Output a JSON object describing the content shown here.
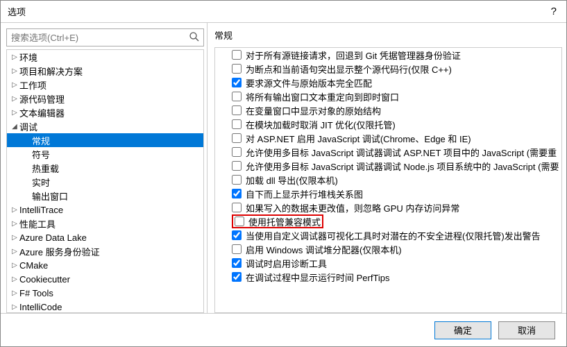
{
  "window": {
    "title": "选项",
    "help": "?"
  },
  "search": {
    "placeholder": "搜索选项(Ctrl+E)"
  },
  "tree": [
    {
      "label": "环境",
      "level": 0,
      "arrow": "▷",
      "selected": false
    },
    {
      "label": "项目和解决方案",
      "level": 0,
      "arrow": "▷",
      "selected": false
    },
    {
      "label": "工作项",
      "level": 0,
      "arrow": "▷",
      "selected": false
    },
    {
      "label": "源代码管理",
      "level": 0,
      "arrow": "▷",
      "selected": false
    },
    {
      "label": "文本编辑器",
      "level": 0,
      "arrow": "▷",
      "selected": false
    },
    {
      "label": "调试",
      "level": 0,
      "arrow": "◢",
      "selected": false
    },
    {
      "label": "常规",
      "level": 1,
      "arrow": "",
      "selected": true
    },
    {
      "label": "符号",
      "level": 1,
      "arrow": "",
      "selected": false
    },
    {
      "label": "热重载",
      "level": 1,
      "arrow": "",
      "selected": false
    },
    {
      "label": "实时",
      "level": 1,
      "arrow": "",
      "selected": false
    },
    {
      "label": "输出窗口",
      "level": 1,
      "arrow": "",
      "selected": false
    },
    {
      "label": "IntelliTrace",
      "level": 0,
      "arrow": "▷",
      "selected": false
    },
    {
      "label": "性能工具",
      "level": 0,
      "arrow": "▷",
      "selected": false
    },
    {
      "label": "Azure Data Lake",
      "level": 0,
      "arrow": "▷",
      "selected": false
    },
    {
      "label": "Azure 服务身份验证",
      "level": 0,
      "arrow": "▷",
      "selected": false
    },
    {
      "label": "CMake",
      "level": 0,
      "arrow": "▷",
      "selected": false
    },
    {
      "label": "Cookiecutter",
      "level": 0,
      "arrow": "▷",
      "selected": false
    },
    {
      "label": "F# Tools",
      "level": 0,
      "arrow": "▷",
      "selected": false
    },
    {
      "label": "IntelliCode",
      "level": 0,
      "arrow": "▷",
      "selected": false
    }
  ],
  "section_label": "常规",
  "options": [
    {
      "label": "对于所有源链接请求，回退到 Git 凭据管理器身份验证",
      "checked": false
    },
    {
      "label": "为断点和当前语句突出显示整个源代码行(仅限 C++)",
      "checked": false
    },
    {
      "label": "要求源文件与原始版本完全匹配",
      "checked": true
    },
    {
      "label": "将所有输出窗口文本重定向到即时窗口",
      "checked": false
    },
    {
      "label": "在变量窗口中显示对象的原始结构",
      "checked": false
    },
    {
      "label": "在模块加载时取消 JIT 优化(仅限托管)",
      "checked": false
    },
    {
      "label": "对 ASP.NET 启用 JavaScript 调试(Chrome、Edge 和 IE)",
      "checked": false
    },
    {
      "label": "允许使用多目标 JavaScript 调试器调试 ASP.NET 项目中的 JavaScript (需要重",
      "checked": false
    },
    {
      "label": "允许使用多目标 JavaScript 调试器调试 Node.js 项目系统中的 JavaScript (需要",
      "checked": false
    },
    {
      "label": "加载 dll 导出(仅限本机)",
      "checked": false
    },
    {
      "label": "自下而上显示并行堆栈关系图",
      "checked": true
    },
    {
      "label": "如果写入的数据未更改值，则忽略 GPU 内存访问异常",
      "checked": false
    },
    {
      "label": "使用托管兼容模式",
      "checked": false,
      "highlighted": true
    },
    {
      "label": "当使用自定义调试器可视化工具时对潜在的不安全进程(仅限托管)发出警告",
      "checked": true
    },
    {
      "label": "启用 Windows 调试堆分配器(仅限本机)",
      "checked": false
    },
    {
      "label": "调试时启用诊断工具",
      "checked": true
    },
    {
      "label": "在调试过程中显示运行时间 PerfTips",
      "checked": true
    }
  ],
  "footer": {
    "ok": "确定",
    "cancel": "取消"
  }
}
